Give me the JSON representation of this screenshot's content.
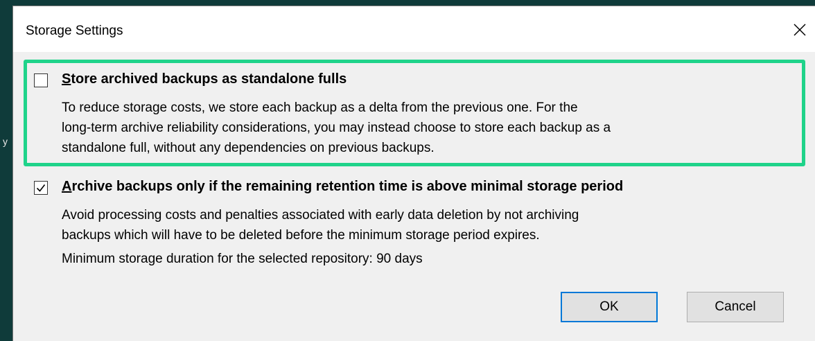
{
  "dialog": {
    "title": "Storage Settings",
    "close_icon": "close-icon"
  },
  "options": [
    {
      "label_first": "S",
      "label_rest": "tore archived backups as standalone fulls",
      "checked": false,
      "description": [
        "To reduce storage costs, we store each backup as a delta from the previous one. For the",
        "long-term archive reliability considerations, you may instead choose to store each backup as a",
        "standalone full, without any dependencies on previous backups."
      ]
    },
    {
      "label_first": "A",
      "label_rest": "rchive backups only if the remaining retention time is above minimal storage period",
      "checked": true,
      "description": [
        "Avoid processing costs and penalties associated with early data deletion by not archiving",
        "backups which will have to be deleted before the minimum storage period expires.",
        "Minimum storage duration for the selected repository: 90 days"
      ]
    }
  ],
  "buttons": {
    "ok": "OK",
    "cancel": "Cancel"
  },
  "background": {
    "edge_mark": "y"
  },
  "colors": {
    "highlight": "#1fd38a",
    "ok_border": "#0078d7",
    "backdrop": "#0f3b3a"
  }
}
